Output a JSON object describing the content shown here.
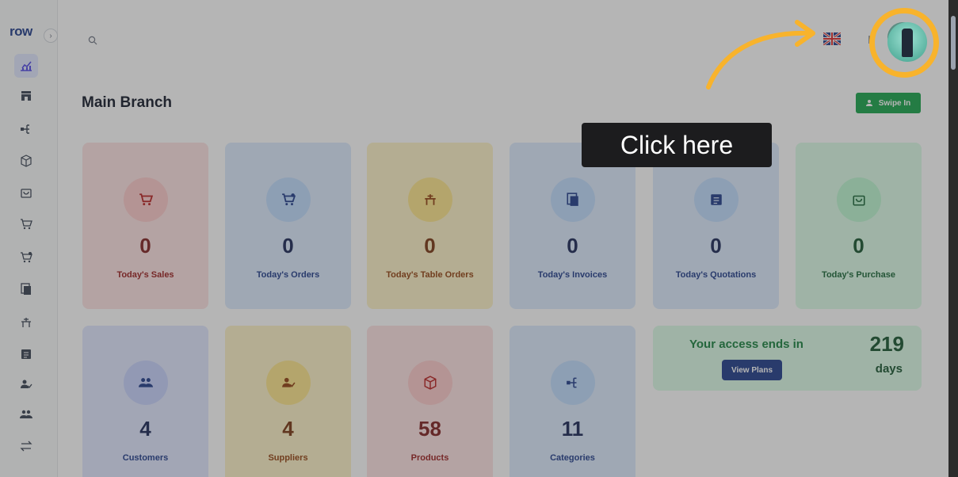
{
  "app": {
    "logo": "row"
  },
  "page": {
    "title": "Main Branch"
  },
  "header": {
    "swipe_in_label": "Swipe In",
    "flag": "uk-flag-icon"
  },
  "tooltip": {
    "text": "Click here"
  },
  "stats": [
    {
      "value": "0",
      "label": "Today's Sales",
      "icon": "cart-icon"
    },
    {
      "value": "0",
      "label": "Today's Orders",
      "icon": "cart-add-icon"
    },
    {
      "value": "0",
      "label": "Today's Table Orders",
      "icon": "table-icon"
    },
    {
      "value": "0",
      "label": "Today's Invoices",
      "icon": "invoice-icon"
    },
    {
      "value": "0",
      "label": "Today's Quotations",
      "icon": "quotation-icon"
    },
    {
      "value": "0",
      "label": "Today's Purchase",
      "icon": "bag-icon"
    },
    {
      "value": "4",
      "label": "Customers",
      "icon": "users-icon"
    },
    {
      "value": "4",
      "label": "Suppliers",
      "icon": "user-check-icon"
    },
    {
      "value": "58",
      "label": "Products",
      "icon": "box-icon"
    },
    {
      "value": "11",
      "label": "Categories",
      "icon": "hierarchy-icon"
    }
  ],
  "access": {
    "text": "Your access ends in",
    "days": "219",
    "days_label": "days",
    "plans_label": "View Plans"
  },
  "colors": {
    "accent": "#f8b32c",
    "primary": "#1e3a8a",
    "success": "#16a34a"
  }
}
